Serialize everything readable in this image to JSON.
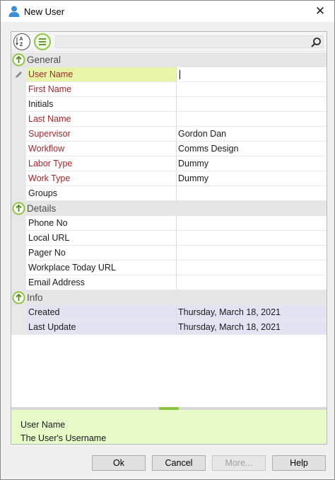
{
  "window": {
    "title": "New User",
    "close_label": "✕",
    "icon": "user-icon"
  },
  "toolbar": {
    "sort_alpha_icon": "sort-alphabetical-icon",
    "sort_category_icon": "sort-categorized-icon",
    "search_icon": "search-icon",
    "search_value": ""
  },
  "grid": {
    "categories": [
      {
        "label": "General",
        "rows": [
          {
            "name": "User Name",
            "value": "",
            "required": true,
            "selected": true
          },
          {
            "name": "First Name",
            "value": "",
            "required": true
          },
          {
            "name": "Initials",
            "value": "",
            "required": false
          },
          {
            "name": "Last Name",
            "value": "",
            "required": true
          },
          {
            "name": "Supervisor",
            "value": "Gordon Dan",
            "required": true
          },
          {
            "name": "Workflow",
            "value": "Comms Design",
            "required": true
          },
          {
            "name": "Labor Type",
            "value": "Dummy",
            "required": true
          },
          {
            "name": "Work Type",
            "value": "Dummy",
            "required": true
          },
          {
            "name": "Groups",
            "value": "",
            "required": false
          }
        ]
      },
      {
        "label": "Details",
        "rows": [
          {
            "name": "Phone No",
            "value": ""
          },
          {
            "name": "Local URL",
            "value": ""
          },
          {
            "name": "Pager No",
            "value": ""
          },
          {
            "name": "Workplace Today URL",
            "value": ""
          },
          {
            "name": "Email Address",
            "value": ""
          }
        ]
      },
      {
        "label": "Info",
        "rows": [
          {
            "name": "Created",
            "value": "Thursday, March 18, 2021",
            "readonly": true
          },
          {
            "name": "Last Update",
            "value": "Thursday, March 18, 2021",
            "readonly": true
          }
        ]
      }
    ]
  },
  "description": {
    "title": "User Name",
    "text": "The User's Username"
  },
  "buttons": {
    "ok": "Ok",
    "cancel": "Cancel",
    "more": "More...",
    "help": "Help"
  },
  "colors": {
    "required_text": "#a8262b",
    "accent_green": "#8cc63f",
    "selected_row": "#e8f5a8",
    "readonly_row": "#e3e3f4",
    "description_bg": "#e6fbc8"
  }
}
